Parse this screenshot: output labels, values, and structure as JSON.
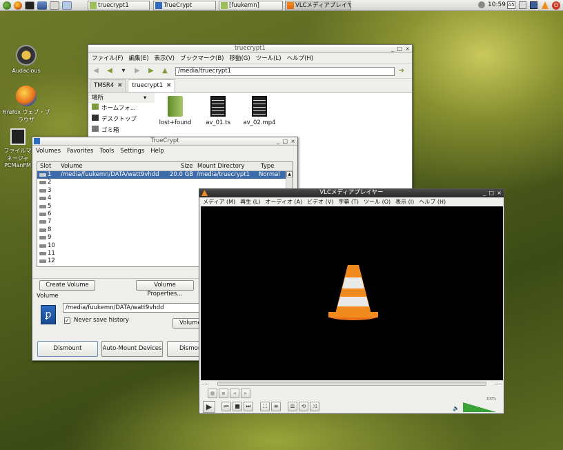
{
  "panel": {
    "tasks": [
      "truecrypt1",
      "TrueCrypt",
      "[fuukemn]",
      "VLCメディアプレイヤー"
    ],
    "clock": "10:59"
  },
  "desktop": {
    "icons": [
      "Audacious",
      "Firefox ウェブ・ブラウザ",
      "ファイルマネージャ PCManFM"
    ]
  },
  "fm": {
    "title": "truecrypt1",
    "menu": [
      "ファイル(F)",
      "編集(E)",
      "表示(V)",
      "ブックマーク(B)",
      "移動(G)",
      "ツール(L)",
      "ヘルプ(H)"
    ],
    "path": "/media/truecrypt1",
    "tabs": [
      "TMSR4",
      "truecrypt1"
    ],
    "places_label": "場所",
    "places": [
      "ホームフォ...",
      "デスクトップ",
      "ゴミ箱"
    ],
    "files": [
      "lost+found",
      "av_01.ts",
      "av_02.mp4"
    ]
  },
  "tc": {
    "title": "TrueCrypt",
    "menu": [
      "Volumes",
      "Favorites",
      "Tools",
      "Settings",
      "Help"
    ],
    "cols": [
      "Slot",
      "Volume",
      "Size",
      "Mount Directory",
      "Type"
    ],
    "row1": {
      "slot": "1",
      "volume": "/media/fuukemn/DATA/watt9vhdd",
      "size": "20.0 GB",
      "mount": "/media/truecrypt1",
      "type": "Normal"
    },
    "slots": [
      "2",
      "3",
      "4",
      "5",
      "6",
      "7",
      "8",
      "9",
      "10",
      "11",
      "12"
    ],
    "create": "Create Volume",
    "props": "Volume Properties...",
    "volume_label": "Volume",
    "volume_path": "/media/fuukemn/DATA/watt9vhdd",
    "never_save": "Never save history",
    "volume_btn": "Volume",
    "dismount": "Dismount",
    "automount": "Auto-Mount Devices",
    "dismount_all": "Dismou"
  },
  "vlc": {
    "title": "VLCメディアプレイヤー",
    "menu": [
      "メディア (M)",
      "再生 (L)",
      "オーディオ (A)",
      "ビデオ (V)",
      "字幕 (T)",
      "ツール (O)",
      "表示 (I)",
      "ヘルプ (H)"
    ],
    "time_left": "--:--",
    "time_right": "--:--",
    "volume": "100%"
  }
}
